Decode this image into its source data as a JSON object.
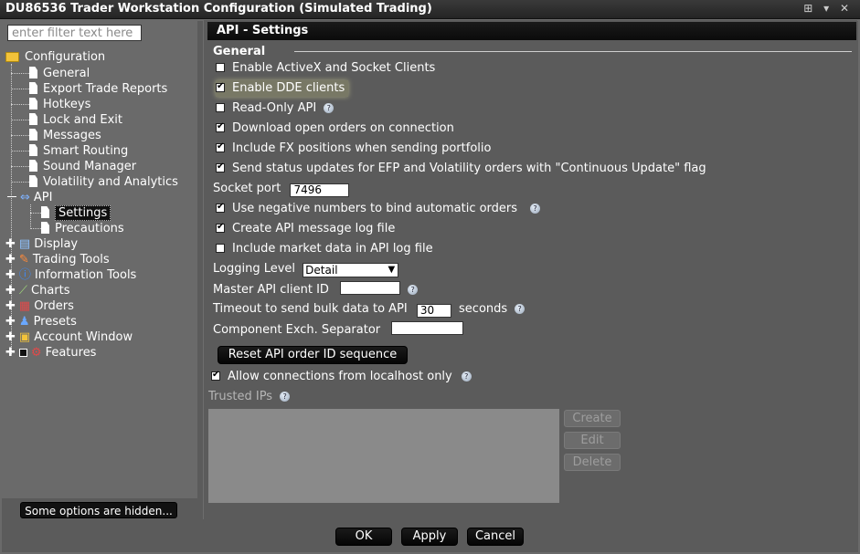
{
  "window": {
    "title": "DU86536 Trader Workstation Configuration (Simulated Trading)",
    "controls": "⊞ ▾ ✕"
  },
  "sidebar": {
    "filter_placeholder": "enter filter text here",
    "root": "Configuration",
    "items": [
      "General",
      "Export Trade Reports",
      "Hotkeys",
      "Lock and Exit",
      "Messages",
      "Smart Routing",
      "Sound Manager",
      "Volatility and Analytics"
    ],
    "api": {
      "label": "API",
      "children": [
        "Settings",
        "Precautions"
      ]
    },
    "groups": [
      "Display",
      "Trading Tools",
      "Information Tools",
      "Charts",
      "Orders",
      "Presets",
      "Account Window",
      "Features"
    ],
    "hidden_options_button": "Some options are hidden..."
  },
  "panel": {
    "title": "API - Settings",
    "group": "General",
    "options": {
      "activex": "Enable ActiveX and Socket Clients",
      "dde": "Enable DDE clients",
      "readonly": "Read-Only API",
      "download_orders": "Download open orders on connection",
      "fx_positions": "Include FX positions when sending portfolio",
      "efp": "Send status updates for EFP and Volatility orders with \"Continuous Update\" flag",
      "negative_numbers": "Use negative numbers to bind automatic orders",
      "log_file": "Create API message log file",
      "market_data": "Include market data in API log file",
      "localhost": "Allow connections from localhost only"
    },
    "socket_port_label": "Socket port",
    "socket_port_value": "7496",
    "logging_level_label": "Logging Level",
    "logging_level_value": "Detail",
    "master_id_label": "Master API client ID",
    "master_id_value": "",
    "timeout_label": "Timeout to send bulk data to API",
    "timeout_value": "30",
    "timeout_unit": "seconds",
    "separator_label": "Component Exch. Separator",
    "separator_value": "",
    "reset_button": "Reset API order ID sequence",
    "trusted_ips_label": "Trusted IPs",
    "ip_buttons": {
      "create": "Create",
      "edit": "Edit",
      "delete": "Delete"
    }
  },
  "footer": {
    "ok": "OK",
    "apply": "Apply",
    "cancel": "Cancel"
  },
  "colors": {
    "background": "#5b5b5b",
    "sidebar": "#6a6a6a",
    "header": "#0b0b0b",
    "selection": "#101010",
    "trusted_ips_box": "#8a8a8a"
  },
  "icons": [
    "folder-icon",
    "document-icon",
    "api-icon",
    "display-icon",
    "trading-tools-icon",
    "info-icon",
    "charts-icon",
    "orders-icon",
    "presets-icon",
    "account-window-icon",
    "features-icon",
    "help-icon"
  ]
}
